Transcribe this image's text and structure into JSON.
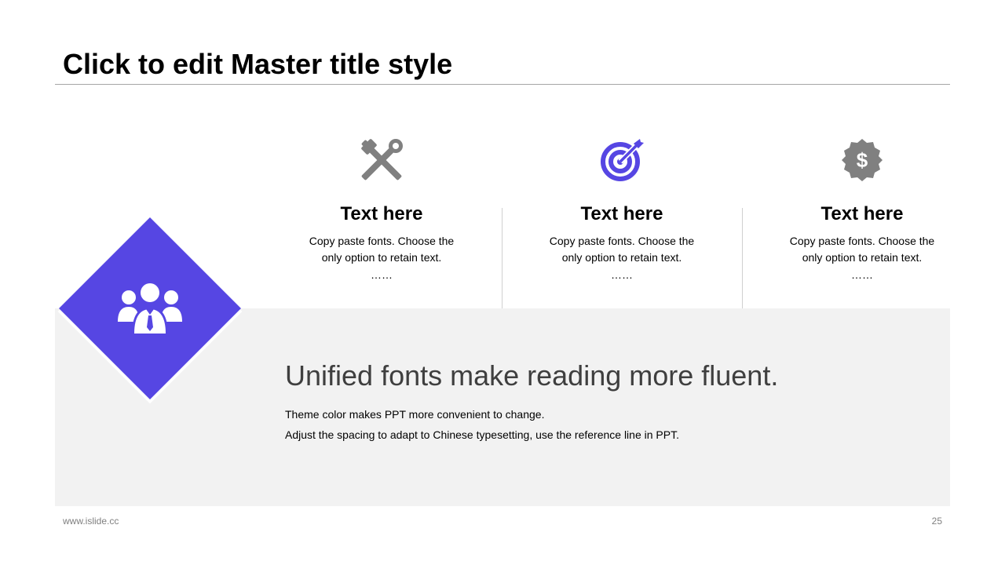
{
  "slide": {
    "title": "Click to edit Master title style",
    "headline": "Unified fonts make reading more fluent.",
    "body_lines": [
      "Theme color makes PPT more convenient to change.",
      "Adjust the spacing to adapt to Chinese typesetting, use the reference line in PPT."
    ],
    "features": [
      {
        "icon": "tools-icon",
        "heading": "Text here",
        "line1": "Copy paste fonts. Choose the",
        "line2": "only option to retain text.",
        "dots": "……"
      },
      {
        "icon": "target-icon",
        "heading": "Text here",
        "line1": "Copy paste fonts. Choose the",
        "line2": "only option to retain text.",
        "dots": "……"
      },
      {
        "icon": "dollar-badge-icon",
        "heading": "Text here",
        "line1": "Copy paste fonts. Choose the",
        "line2": "only option to retain text.",
        "dots": "……"
      }
    ],
    "feature_icon_symbol": "$",
    "diamond_icon": "team-icon"
  },
  "footer": {
    "website": "www.islide.cc",
    "page_number": "25"
  },
  "colors": {
    "accent": "#5646e3",
    "icon_gray": "#808080",
    "band_gray": "#f2f2f2",
    "title_rule": "#a6a6a6"
  }
}
